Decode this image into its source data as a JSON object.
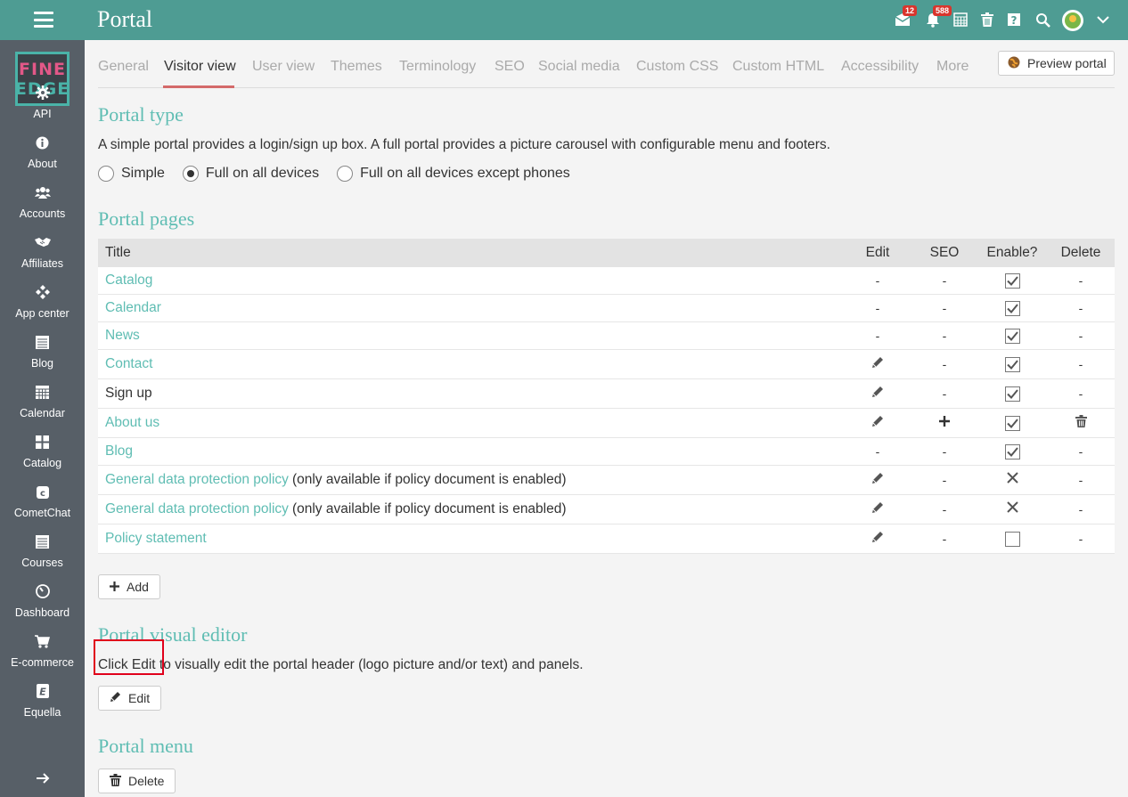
{
  "topbar": {
    "title": "Portal",
    "messages_badge": "12",
    "notifications_badge": "588"
  },
  "logo": {
    "line1": "FINE",
    "line2": "EDGE"
  },
  "sidebar": {
    "items": [
      {
        "label": "API",
        "icon": "gear-icon"
      },
      {
        "label": "About",
        "icon": "info-icon"
      },
      {
        "label": "Accounts",
        "icon": "users-icon"
      },
      {
        "label": "Affiliates",
        "icon": "handshake-icon"
      },
      {
        "label": "App center",
        "icon": "app-center-icon"
      },
      {
        "label": "Blog",
        "icon": "blog-icon"
      },
      {
        "label": "Calendar",
        "icon": "calendar-icon"
      },
      {
        "label": "Catalog",
        "icon": "catalog-icon"
      },
      {
        "label": "CometChat",
        "icon": "cometchat-icon"
      },
      {
        "label": "Courses",
        "icon": "courses-icon"
      },
      {
        "label": "Dashboard",
        "icon": "dashboard-icon"
      },
      {
        "label": "E-commerce",
        "icon": "cart-icon"
      },
      {
        "label": "Equella",
        "icon": "equella-icon"
      }
    ]
  },
  "tabs": [
    "General",
    "Visitor view",
    "User view",
    "Themes",
    "Terminology",
    "SEO",
    "Social media",
    "Custom CSS",
    "Custom HTML",
    "Accessibility",
    "More"
  ],
  "active_tab": "Visitor view",
  "preview_button": "Preview portal",
  "portal_type": {
    "title": "Portal type",
    "description": "A simple portal provides a login/sign up box. A full portal provides a picture carousel with configurable menu and footers.",
    "options": [
      "Simple",
      "Full on all devices",
      "Full on all devices except phones"
    ],
    "selected": "Full on all devices"
  },
  "portal_pages": {
    "title": "Portal pages",
    "columns": [
      "Title",
      "Edit",
      "SEO",
      "Enable?",
      "Delete"
    ],
    "rows": [
      {
        "title": "Catalog",
        "note": "",
        "link": true,
        "edit": "-",
        "seo": "-",
        "enable": "checked",
        "delete": "-"
      },
      {
        "title": "Calendar",
        "note": "",
        "link": true,
        "edit": "-",
        "seo": "-",
        "enable": "checked",
        "delete": "-"
      },
      {
        "title": "News",
        "note": "",
        "link": true,
        "edit": "-",
        "seo": "-",
        "enable": "checked",
        "delete": "-"
      },
      {
        "title": "Contact",
        "note": "",
        "link": true,
        "edit": "pencil",
        "seo": "-",
        "enable": "checked",
        "delete": "-"
      },
      {
        "title": "Sign up",
        "note": "",
        "link": false,
        "edit": "pencil",
        "seo": "-",
        "enable": "checked",
        "delete": "-"
      },
      {
        "title": "About us",
        "note": "",
        "link": true,
        "edit": "pencil",
        "seo": "plus",
        "enable": "checked",
        "delete": "trash"
      },
      {
        "title": "Blog",
        "note": "",
        "link": true,
        "edit": "-",
        "seo": "-",
        "enable": "checked",
        "delete": "-"
      },
      {
        "title": "General data protection policy",
        "note": "(only available if policy document is enabled)",
        "link": true,
        "edit": "pencil",
        "seo": "-",
        "enable": "cross",
        "delete": "-"
      },
      {
        "title": "General data protection policy",
        "note": "(only available if policy document is enabled)",
        "link": true,
        "edit": "pencil",
        "seo": "-",
        "enable": "cross",
        "delete": "-"
      },
      {
        "title": "Policy statement",
        "note": "",
        "link": true,
        "edit": "pencil",
        "seo": "-",
        "enable": "unchecked",
        "delete": "-"
      }
    ],
    "add_button": "Add"
  },
  "visual_editor": {
    "title": "Portal visual editor",
    "description": "Click Edit to visually edit the portal header (logo picture and/or text) and panels.",
    "edit_button": "Edit"
  },
  "portal_menu": {
    "title": "Portal menu",
    "delete_button": "Delete"
  },
  "colors": {
    "topbar": "#4e9c93",
    "sidebar": "#575f67",
    "accent": "#5fbdb3",
    "active_tab_underline": "#d46a6a",
    "badge": "#d9352d",
    "highlight": "#e0001b"
  }
}
